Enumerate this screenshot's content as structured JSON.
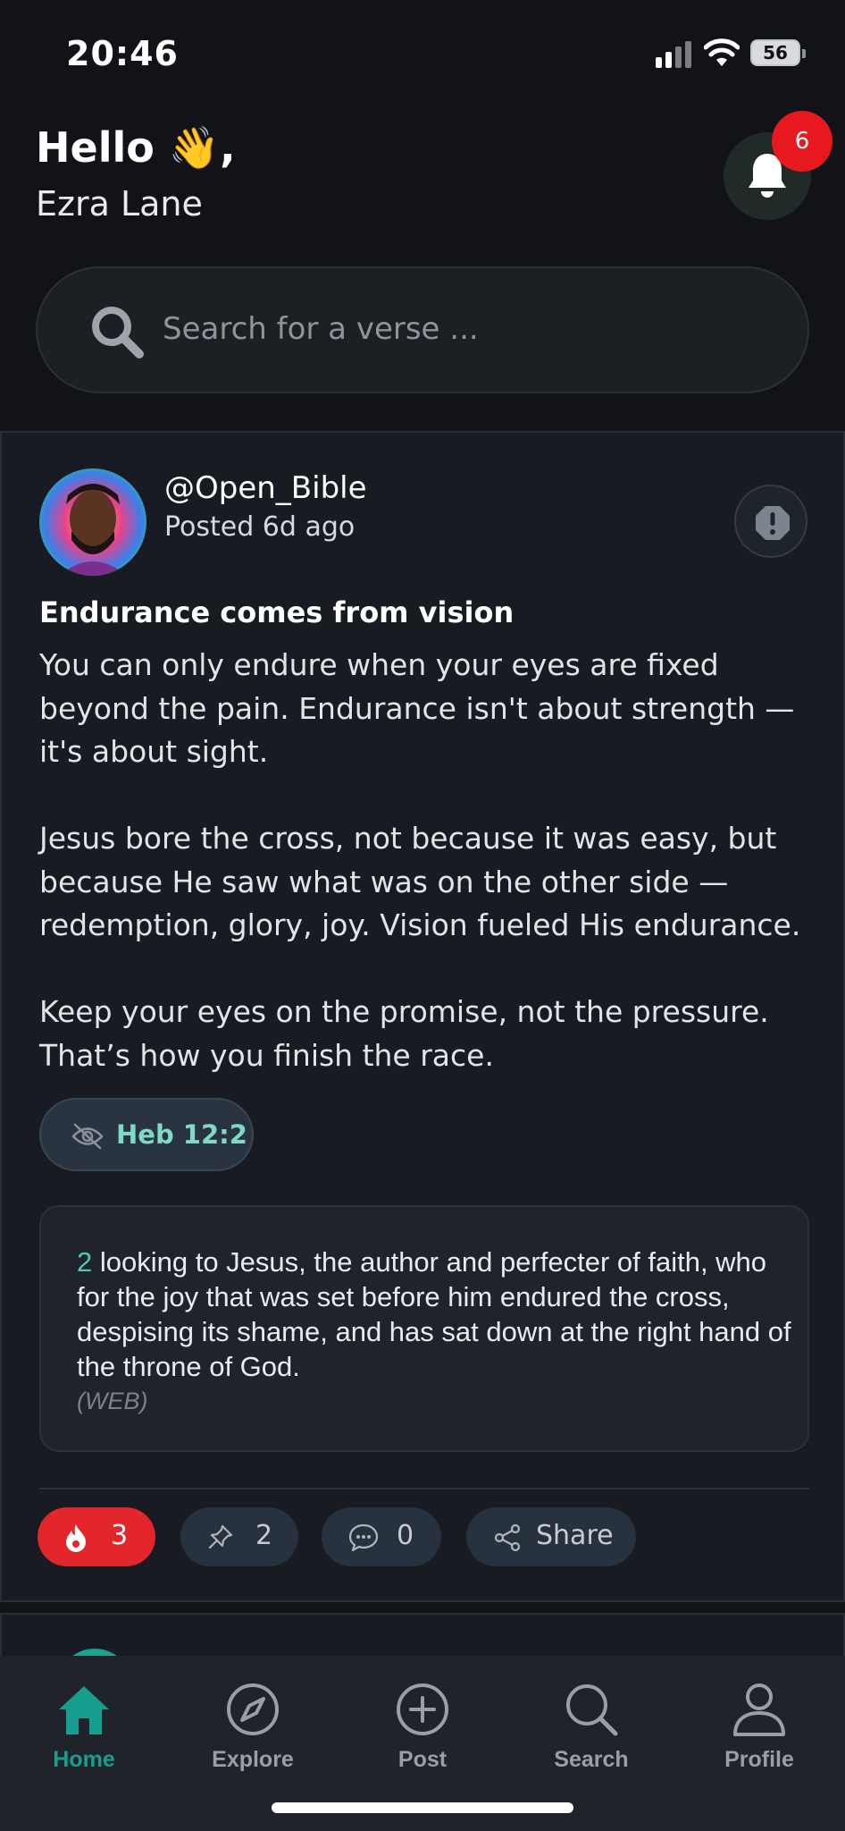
{
  "status_bar": {
    "time": "20:46",
    "battery": "56"
  },
  "header": {
    "greeting": "Hello 👋,",
    "user_name": "Ezra Lane",
    "notification_count": "6"
  },
  "search": {
    "placeholder": "Search for a verse ..."
  },
  "post": {
    "author_handle": "@Open_Bible",
    "posted": "Posted 6d ago",
    "title": "Endurance comes from vision",
    "paragraphs": [
      "You can only endure when your eyes are fixed beyond the pain. Endurance isn't about strength — it's about sight.",
      "Jesus bore the cross, not because it was easy, but because He saw what was on the other side — redemption, glory, joy. Vision fueled His endurance.",
      "Keep your eyes on the promise, not the pressure. That’s how you finish the race."
    ],
    "reference": "Heb 12:2",
    "verse": {
      "number": "2",
      "text": " looking to Jesus, the author and perfecter of faith, who for the joy that was set before him endured the cross, despising its shame, and has sat down at the right hand of the throne of God.",
      "version": "(WEB)"
    },
    "actions": {
      "fire_count": "3",
      "pin_count": "2",
      "comment_count": "0",
      "share_label": "Share"
    }
  },
  "nav": [
    {
      "label": "Home",
      "icon": "home-icon",
      "active": true
    },
    {
      "label": "Explore",
      "icon": "compass-icon"
    },
    {
      "label": "Post",
      "icon": "plus-circle-icon"
    },
    {
      "label": "Search",
      "icon": "search-icon"
    },
    {
      "label": "Profile",
      "icon": "user-icon"
    }
  ],
  "colors": {
    "accent": "#169e8f",
    "fire": "#e2262b",
    "badge": "#e8191e",
    "reference_text": "#7fd8c8"
  }
}
